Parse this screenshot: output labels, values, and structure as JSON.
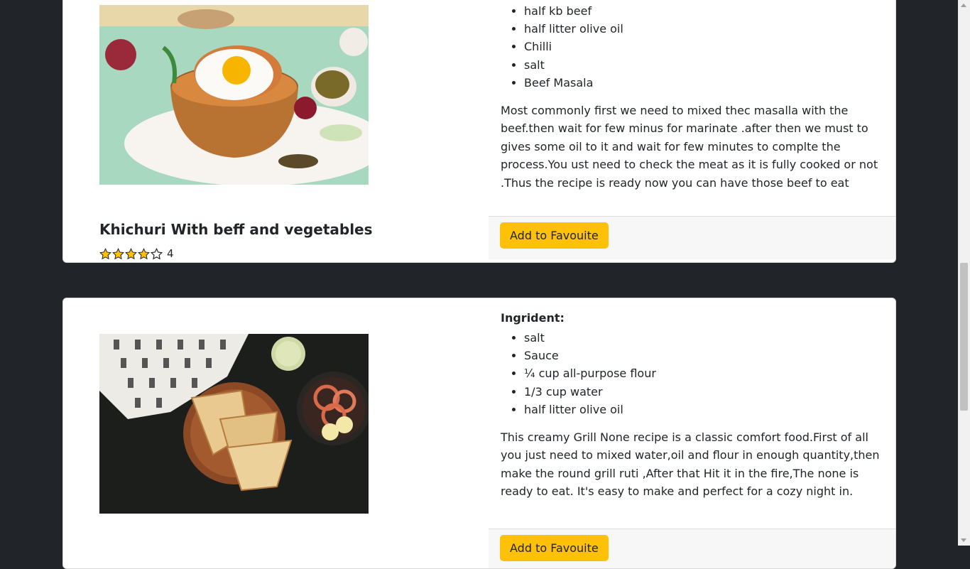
{
  "recipes": [
    {
      "title": "Khichuri With beff and vegetables",
      "rating_value": 4,
      "rating_text": "4",
      "stars": [
        "star-filled",
        "star-filled",
        "star-filled",
        "star-filled",
        "star-empty"
      ],
      "image": "biryani-with-fried-egg-photo",
      "ingredients_label": "",
      "ingredients": [
        "half kb beef",
        "half litter olive oil",
        "Chilli",
        "salt",
        "Beef Masala"
      ],
      "description": "Most commonly first we need to mixed thec masalla with the beef.then wait for few minus for marinate .after then we must to gives some oil to it and wait for few minutes to complte the process.You ust need to check the meat as it is fully cooked or not .Thus the recipe is ready now you can have those beef to eat",
      "button_label": "Add to Favouite"
    },
    {
      "title": "",
      "image": "grilled-naan-with-salad-photo",
      "ingredients_label": "Ingrident:",
      "ingredients": [
        "salt",
        "Sauce",
        "¼ cup all-purpose flour",
        "1/3 cup water",
        "half litter olive oil"
      ],
      "description": "This creamy Grill None recipe is a classic comfort food.First of all you just need to mixed water,oil and flour in enough quantity,then make the round grill ruti ,After that Hit it in the fire,The none is ready to eat. It's easy to make and perfect for a cozy night in.",
      "button_label": "Add to Favouite"
    }
  ],
  "colors": {
    "page_background": "#212529",
    "card_background": "#ffffff",
    "button_warning": "#ffc107",
    "star_color": "#ffc107",
    "footer_background": "#f7f7f7"
  }
}
